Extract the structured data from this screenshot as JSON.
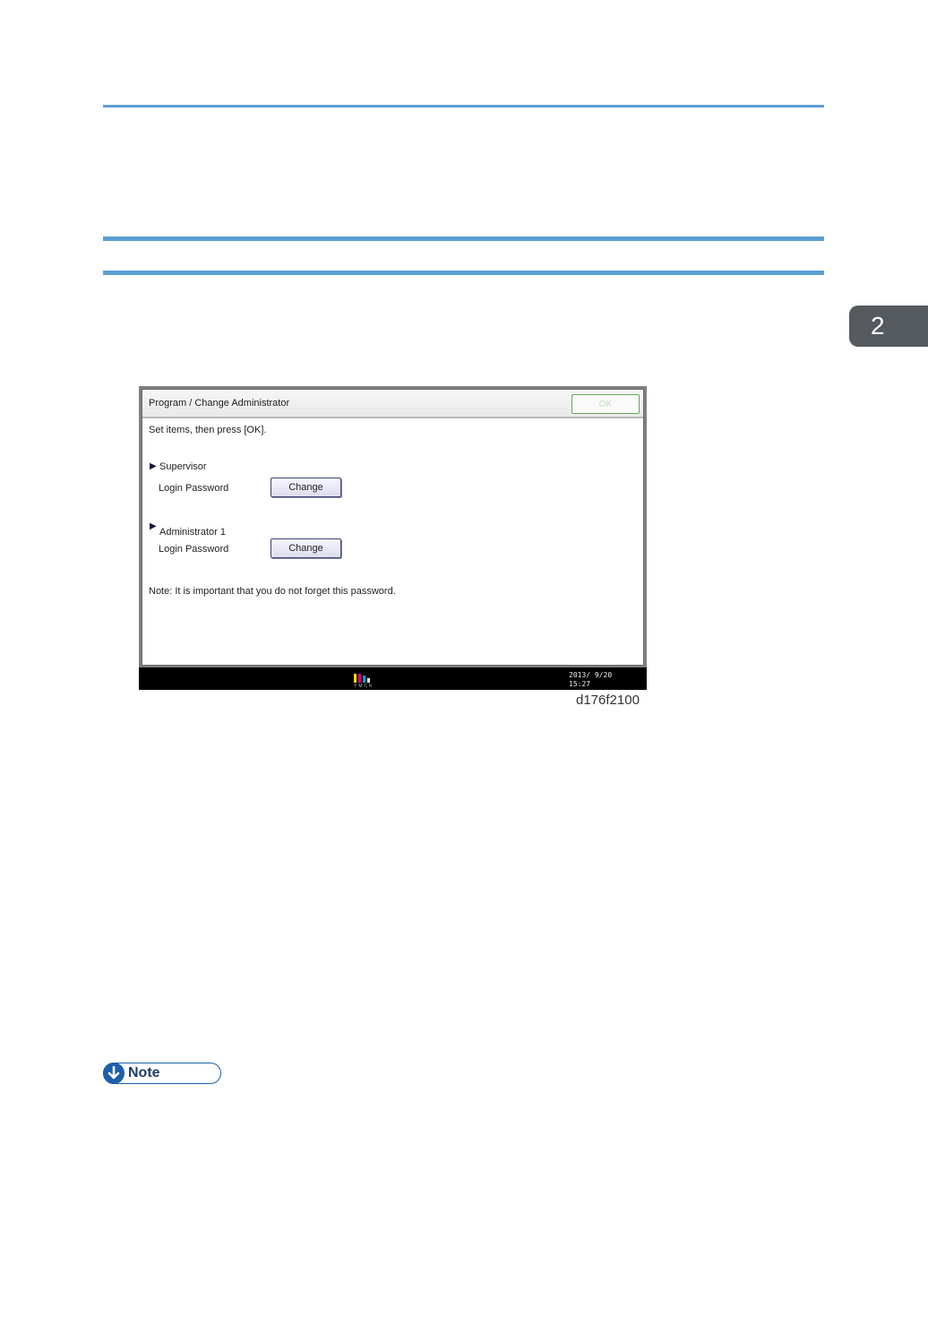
{
  "chapter_tab": {
    "number": "2"
  },
  "dialog": {
    "title": "Program / Change Administrator",
    "ok_label": "OK",
    "instruction": "Set items, then press [OK].",
    "supervisor": {
      "heading": "Supervisor",
      "field_label": "Login Password",
      "button_label": "Change"
    },
    "administrator": {
      "heading": "Administrator 1",
      "field_label": "Login Password",
      "button_label": "Change"
    },
    "note": "Note: It is important that you do not forget this password."
  },
  "statusbar": {
    "logo_caption": "YMCK",
    "date": "2013/ 9/20",
    "time": "15:27"
  },
  "figure_caption": "d176f2100",
  "note_badge": {
    "label": "Note"
  },
  "colors": {
    "rule_blue": "#5a9fd4",
    "note_blue": "#1e5fa8",
    "chapter_tab": "#555a5f"
  }
}
